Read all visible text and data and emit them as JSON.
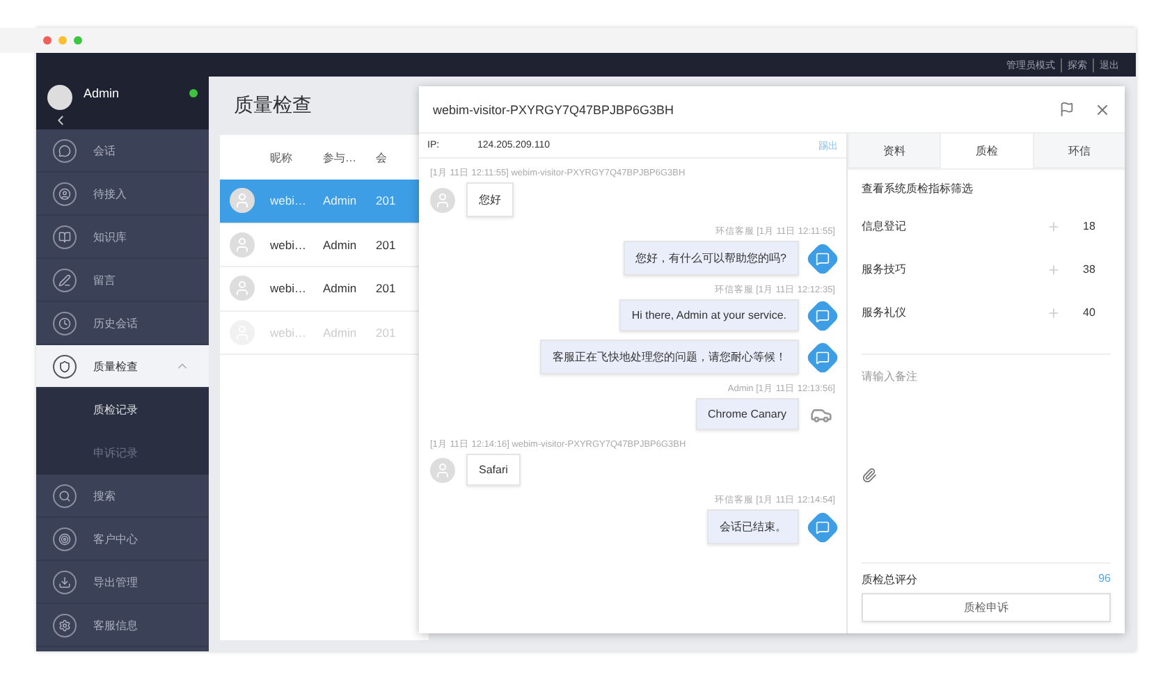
{
  "window": {
    "top_links": [
      "管理员模式",
      "探索",
      "退出"
    ]
  },
  "sidebar": {
    "user": {
      "name": "Admin",
      "online": true
    },
    "items": [
      {
        "label": "会话",
        "selected": false
      },
      {
        "label": "待接入",
        "selected": false
      },
      {
        "label": "知识库",
        "selected": false
      },
      {
        "label": "留言",
        "selected": false
      },
      {
        "label": "历史会话",
        "selected": false
      },
      {
        "label": "质量检查",
        "selected": true,
        "expanded": true,
        "children": [
          {
            "label": "质检记录",
            "selected": true
          },
          {
            "label": "申诉记录",
            "selected": false
          }
        ]
      },
      {
        "label": "搜索",
        "selected": false
      },
      {
        "label": "客户中心",
        "selected": false
      },
      {
        "label": "导出管理",
        "selected": false
      },
      {
        "label": "客服信息",
        "selected": false
      }
    ]
  },
  "page": {
    "title": "质量检查"
  },
  "table": {
    "columns": [
      "昵称",
      "参与…",
      "会"
    ],
    "rows": [
      {
        "cells": [
          "webi…",
          "Admin",
          "201"
        ],
        "selected": true,
        "dimmed": false
      },
      {
        "cells": [
          "webi…",
          "Admin",
          "201"
        ],
        "selected": false,
        "dimmed": false
      },
      {
        "cells": [
          "webi…",
          "Admin",
          "201"
        ],
        "selected": false,
        "dimmed": false
      },
      {
        "cells": [
          "webi…",
          "Admin",
          "201"
        ],
        "selected": false,
        "dimmed": true
      }
    ]
  },
  "dialog": {
    "title": "webim-visitor-PXYRGY7Q47BPJBP6G3BH",
    "ip_label": "IP:",
    "ip": "124.205.209.110",
    "ip_action": "踢出",
    "messages": [
      {
        "kind": "visitor",
        "meta": "[1月 11日 12:11:55] webim-visitor-PXYRGY7Q47BPJBP6G3BH",
        "text": "您好"
      },
      {
        "kind": "agent",
        "meta": "环信客服 [1月 11日 12:11:55]",
        "text": "您好，有什么可以帮助您的吗?"
      },
      {
        "kind": "agent",
        "meta": "环信客服 [1月 11日 12:12:35]",
        "text": "Hi there, Admin at your service."
      },
      {
        "kind": "agent",
        "text": "客服正在飞快地处理您的问题，请您耐心等候！"
      },
      {
        "kind": "admin",
        "meta": "Admin [1月 11日 12:13:56]",
        "text": "Chrome Canary"
      },
      {
        "kind": "visitor",
        "meta": "[1月 11日 12:14:16] webim-visitor-PXYRGY7Q47BPJBP6G3BH",
        "text": "Safari"
      },
      {
        "kind": "agent",
        "meta": "环信客服 [1月 11日 12:14:54]",
        "text": "会话已结束。"
      }
    ],
    "tabs": [
      {
        "label": "资料",
        "selected": false
      },
      {
        "label": "质检",
        "selected": true
      },
      {
        "label": "环信",
        "selected": false
      }
    ],
    "quality": {
      "heading": "查看系统质检指标筛选",
      "criteria": [
        {
          "name": "信息登记",
          "score": "18"
        },
        {
          "name": "服务技巧",
          "score": "38"
        },
        {
          "name": "服务礼仪",
          "score": "40"
        }
      ],
      "remark_placeholder": "请输入备注",
      "total_label": "质检总评分",
      "total": "96",
      "appeal_button": "质检申诉"
    }
  }
}
